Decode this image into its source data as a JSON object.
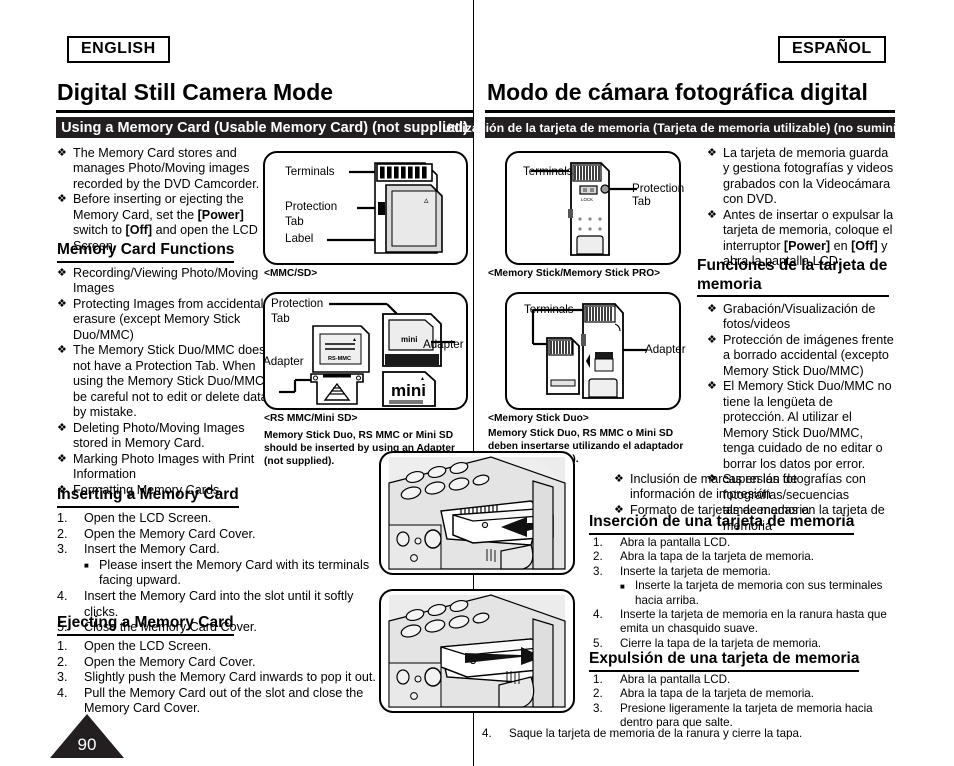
{
  "header": {
    "lang_left": "ENGLISH",
    "lang_right": "ESPAÑOL",
    "chapter_left": "Digital Still Camera Mode",
    "chapter_right": "Modo de cámara fotográfica digital",
    "section_left": "Using a Memory Card (Usable Memory Card) (not supplied)",
    "section_right": "Utilización de la tarjeta de memoria (Tarjeta de memoria utilizable) (no suministrada)"
  },
  "page_number": "90",
  "english": {
    "intro_bullets": [
      "The Memory Card stores and manages Photo/Moving images recorded by the DVD Camcorder.",
      "Before inserting or ejecting the Memory Card, set the [Power] switch to [Off] and open the LCD Screen."
    ],
    "functions_heading": "Memory Card Functions",
    "function_bullets": [
      "Recording/Viewing Photo/Moving Images",
      "Protecting Images from accidental erasure (except Memory Stick Duo/MMC)",
      "The Memory Stick Duo/MMC does not have a Protection Tab. When using the Memory Stick Duo/MMC, be careful not to edit or delete data by mistake.",
      "Deleting Photo/Moving Images stored in Memory Card.",
      "Marking Photo Images with Print Information",
      "Formatting Memory Cards"
    ],
    "inserting_heading": "Inserting a Memory Card",
    "inserting_steps": [
      "Open the LCD Screen.",
      "Open the Memory Card Cover.",
      "Insert the Memory Card.",
      "Insert the Memory Card into the slot until it softly clicks.",
      "Close the Memory Card Cover."
    ],
    "inserting_substep": "Please insert the Memory Card with its terminals facing upward.",
    "ejecting_heading": "Ejecting a Memory Card",
    "ejecting_steps": [
      "Open the LCD Screen.",
      "Open the Memory Card Cover.",
      "Slightly push the Memory Card inwards to pop it out.",
      "Pull the Memory Card out of the slot and close the Memory Card Cover."
    ]
  },
  "spanish": {
    "intro_bullets": [
      "La tarjeta de memoria guarda y gestiona fotografías y videos grabados con la Videocámara con DVD.",
      "Antes de insertar o expulsar la tarjeta de memoria, coloque el interruptor [Power] en [Off] y abra la pantalla LCD."
    ],
    "functions_heading": "Funciones de la tarjeta de memoria",
    "function_bullets": [
      "Grabación/Visualización de fotos/videos",
      "Protección de imágenes frente a borrado accidental (excepto Memory Stick Duo/MMC)",
      "El Memory Stick Duo/MMC no tiene la lengüeta de protección. Al utilizar el Memory Stick Duo/MMC, tenga cuidado de no editar o borrar los datos por error.",
      "Supresión de fotografías/secuencias almacenadas en la tarjeta de memoria"
    ],
    "function_bullets_wide": [
      "Inclusión de marcas en las fotografías con información de impresión",
      "Formato de tarjetas de memoria"
    ],
    "inserting_heading": "Inserción de una tarjeta de memoria",
    "inserting_steps": [
      "Abra la pantalla LCD.",
      "Abra la tapa de la tarjeta de memoria.",
      "Inserte la tarjeta de memoria.",
      "Inserte la tarjeta de memoria en la ranura hasta que emita un chasquido suave.",
      "Cierre la tapa de la tarjeta de memoria."
    ],
    "inserting_substep": "Inserte la tarjeta de memoria con sus terminales hacia arriba.",
    "ejecting_heading": "Expulsión de una tarjeta de memoria",
    "ejecting_steps": [
      "Abra la pantalla LCD.",
      "Abra la tapa de la tarjeta de memoria.",
      "Presione ligeramente la tarjeta de memoria hacia dentro para que salte.",
      "Saque la tarjeta de memoria de la ranura y cierre la tapa."
    ]
  },
  "figures": {
    "mmc_sd": {
      "caption": "<MMC/SD>",
      "labels": {
        "terminals": "Terminals",
        "protection_tab_1": "Protection",
        "protection_tab_2": "Tab",
        "label": "Label"
      }
    },
    "rs_mmc": {
      "caption": "<RS MMC/Mini SD>",
      "note": "Memory Stick Duo, RS MMC or Mini SD should be inserted by using an Adapter (not supplied).",
      "labels": {
        "protection_1": "Protection",
        "protection_2": "Tab",
        "adapter_right": "Adapter",
        "adapter_left": "Adapter",
        "chip_text": "RS-MMC",
        "mini_small": "mini",
        "mini_big": "mini"
      }
    },
    "memory_stick": {
      "caption": "<Memory Stick/Memory Stick PRO>",
      "labels": {
        "terminals": "Terminals",
        "protection_tab": "Protection Tab"
      }
    },
    "memory_stick_duo": {
      "caption": "<Memory Stick Duo>",
      "note": "Memory Stick Duo, RS MMC o Mini SD deben insertarse utilizando el adaptador (no se suministra).",
      "labels": {
        "terminals": "Terminals",
        "adapter": "Adapter"
      }
    },
    "camcorder_insert": {
      "name": "camcorder-inserting-card"
    },
    "camcorder_eject": {
      "name": "camcorder-ejecting-card"
    }
  },
  "colors": {
    "ink": "#231f20",
    "paper": "#ffffff",
    "fig_fill": "#e8e8e8",
    "fig_fill_dark": "#bdbdbd"
  }
}
